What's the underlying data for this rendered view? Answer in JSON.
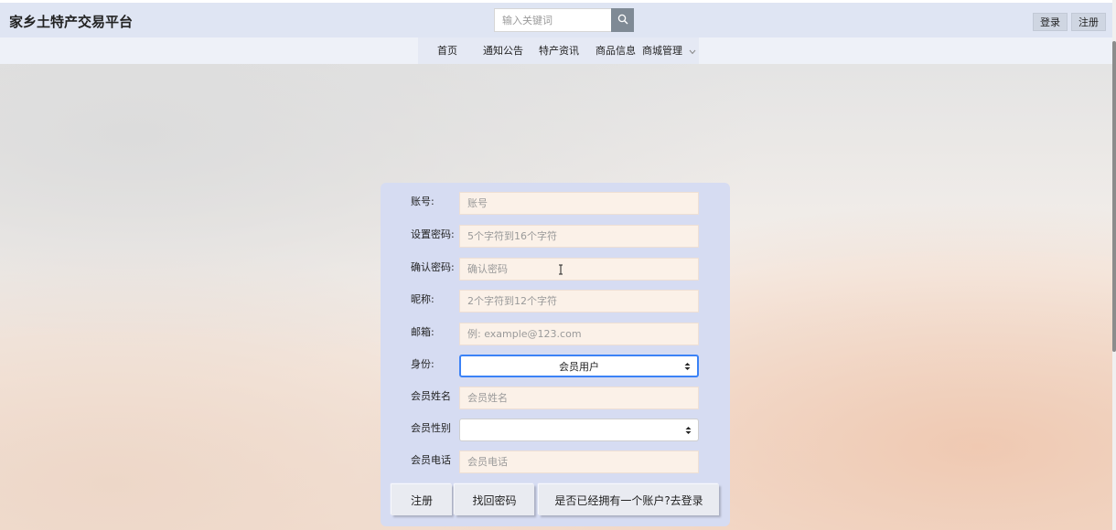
{
  "header": {
    "brand": "家乡土特产交易平台",
    "search_placeholder": "输入关键词",
    "login_label": "登录",
    "register_label": "注册"
  },
  "nav": {
    "items": [
      {
        "label": "首页"
      },
      {
        "label": "通知公告"
      },
      {
        "label": "特产资讯"
      },
      {
        "label": "商品信息"
      },
      {
        "label": "商城管理"
      }
    ]
  },
  "form": {
    "fields": [
      {
        "label": "账号:",
        "placeholder": "账号"
      },
      {
        "label": "设置密码:",
        "placeholder": "5个字符到16个字符"
      },
      {
        "label": "确认密码:",
        "placeholder": "确认密码"
      },
      {
        "label": "昵称:",
        "placeholder": "2个字符到12个字符"
      },
      {
        "label": "邮箱:",
        "placeholder": "例: example@123.com"
      },
      {
        "label": "身份:",
        "selected": "会员用户"
      },
      {
        "label": "会员姓名",
        "placeholder": "会员姓名"
      },
      {
        "label": "会员性别",
        "selected": ""
      },
      {
        "label": "会员电话",
        "placeholder": "会员电话"
      }
    ],
    "buttons": {
      "register": "注册",
      "recover": "找回密码",
      "to_login": "是否已经拥有一个账户?去登录"
    }
  },
  "colors": {
    "header_bg": "#dfe5f3",
    "card_bg": "#d6dcf2",
    "input_bg": "#fbf1e8",
    "focus_border": "#3b82f6"
  },
  "icons": {
    "search": "search-icon",
    "dropdown": "chevron-down-icon",
    "select_arrows": "select-arrows-icon"
  }
}
